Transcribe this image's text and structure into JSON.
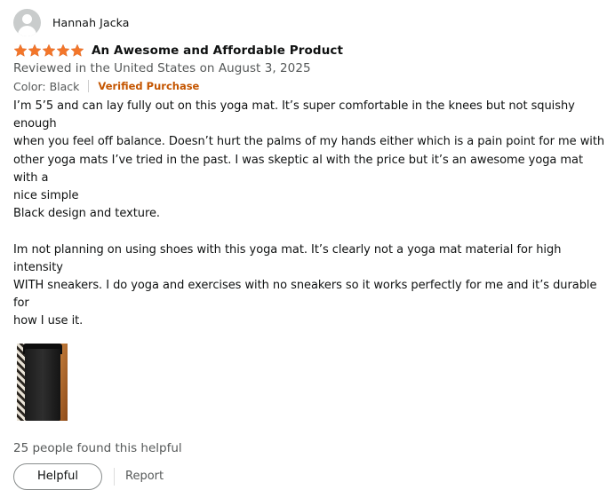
{
  "reviewer": {
    "name": "Hannah Jacka"
  },
  "rating": {
    "stars": 5,
    "max": 5,
    "color": "#f3762a"
  },
  "review": {
    "title": "An Awesome and Affordable Product",
    "date": "Reviewed in the United States on August 3, 2025",
    "color_option": "Color: Black",
    "verified_label": "Verified Purchase",
    "body": "I’m 5’5 and can lay fully out on this yoga mat. It’s super comfortable in the knees but not squishy enough\nwhen you feel off balance. Doesn’t hurt the palms of my hands either which is a pain point for me with\nother yoga mats I’ve tried in the past. I was skeptic al with the price but it’s an awesome yoga mat with a\nnice simple\nBlack design and texture.\n\nIm not planning on using shoes with this yoga mat. It’s clearly not a yoga mat material for high intensity\nWITH sneakers. I do yoga and exercises with no sneakers so it works perfectly for me and it’s durable for\nhow I use it."
  },
  "helpful": {
    "count_text": "25 people found this helpful",
    "button_label": "Helpful",
    "report_label": "Report"
  },
  "colors": {
    "verified": "#c45500",
    "secondary_text": "#565959",
    "primary_text": "#0f1111"
  },
  "icons": {
    "avatar": "person-silhouette-icon",
    "star": "star-icon"
  }
}
